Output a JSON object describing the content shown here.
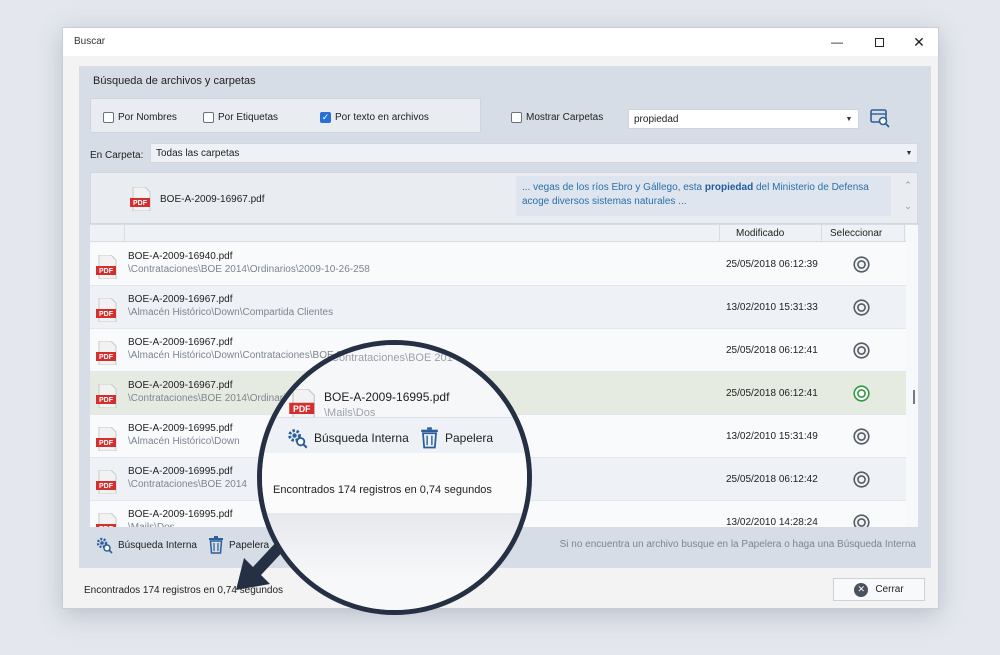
{
  "window": {
    "title": "Buscar"
  },
  "search": {
    "section_title": "Búsqueda de archivos y carpetas",
    "options": [
      {
        "label": "Por Nombres",
        "checked": false
      },
      {
        "label": "Por Etiquetas",
        "checked": false
      },
      {
        "label": "Por texto en archivos",
        "checked": true
      }
    ],
    "show_folders": {
      "label": "Mostrar Carpetas",
      "checked": false
    },
    "query": "propiedad"
  },
  "folder": {
    "label": "En Carpeta:",
    "value": "Todas las carpetas"
  },
  "preview": {
    "file": "BOE-A-2009-16967.pdf",
    "snippet_before": "... vegas de los ríos Ebro y Gállego, esta ",
    "snippet_match": "propiedad",
    "snippet_after": " del Ministerio de Defensa acoge diversos sistemas naturales ..."
  },
  "table": {
    "columns": {
      "modified": "Modificado",
      "select": "Seleccionar"
    },
    "rows": [
      {
        "name": "BOE-A-2009-16940.pdf",
        "path": "\\Contrataciones\\BOE 2014\\Ordinarios\\2009-10-26-258",
        "date": "25/05/2018 06:12:39"
      },
      {
        "name": "BOE-A-2009-16967.pdf",
        "path": "\\Almacén Histórico\\Down\\Compartida Clientes",
        "date": "13/02/2010 15:31:33"
      },
      {
        "name": "BOE-A-2009-16967.pdf",
        "path": "\\Almacén Histórico\\Down\\Contrataciones\\BOE 2014\\2009-10-26-258",
        "date": "25/05/2018 06:12:41"
      },
      {
        "name": "BOE-A-2009-16967.pdf",
        "path": "\\Contrataciones\\BOE 2014\\Ordinarios",
        "date": "25/05/2018 06:12:41",
        "selected": true
      },
      {
        "name": "BOE-A-2009-16995.pdf",
        "path": "\\Almacén Histórico\\Down",
        "date": "13/02/2010 15:31:49"
      },
      {
        "name": "BOE-A-2009-16995.pdf",
        "path": "\\Contrataciones\\BOE 2014",
        "date": "25/05/2018 06:12:42"
      },
      {
        "name": "BOE-A-2009-16995.pdf",
        "path": "\\Mails\\Dos",
        "date": "13/02/2010 14:28:24"
      }
    ]
  },
  "actions": {
    "internal_search": "Búsqueda Interna",
    "trash": "Papelera",
    "hint": "Si no encuentra un archivo busque en la Papelera o haga una Búsqueda Interna"
  },
  "status": "Encontrados 174 registros en 0,74 segundos",
  "close_label": "Cerrar",
  "magnifier": {
    "ghost_text": "\\Contrataciones\\BOE 2014",
    "file": "BOE-A-2009-16995.pdf",
    "path": "\\Mails\\Dos",
    "internal_search": "Búsqueda Interna",
    "trash": "Papelera",
    "status": "Encontrados 174 registros en 0,74 segundos"
  },
  "colors": {
    "accent": "#2a6fd6",
    "selected_ring": "#2e9a3e",
    "pdf_red": "#d32f2f"
  }
}
